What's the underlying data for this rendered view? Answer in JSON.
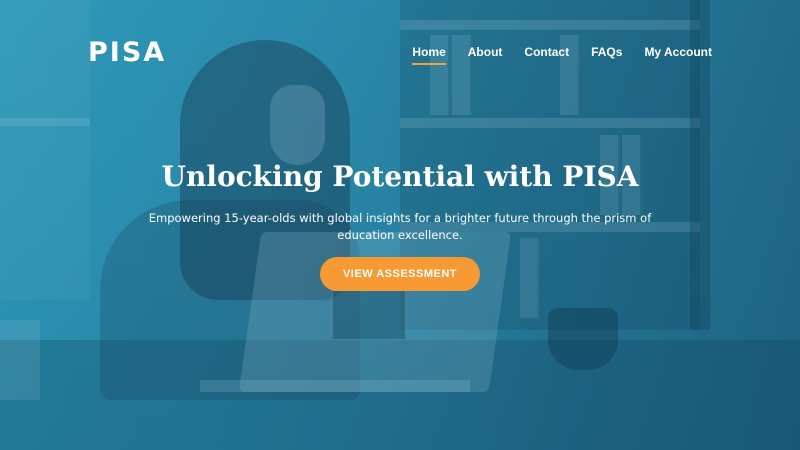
{
  "header": {
    "logo_text": "PISA",
    "nav": [
      {
        "label": "Home",
        "active": true
      },
      {
        "label": "About",
        "active": false
      },
      {
        "label": "Contact",
        "active": false
      },
      {
        "label": "FAQs",
        "active": false
      },
      {
        "label": "My Account",
        "active": false
      }
    ]
  },
  "hero": {
    "headline": "Unlocking Potential with PISA",
    "subtext": "Empowering 15-year-olds with global insights for a brighter future through the prism of education excellence.",
    "cta_label": "VIEW ASSESSMENT"
  },
  "colors": {
    "accent": "#f79a33",
    "overlay": "#2b8fb0",
    "text": "#ffffff"
  }
}
